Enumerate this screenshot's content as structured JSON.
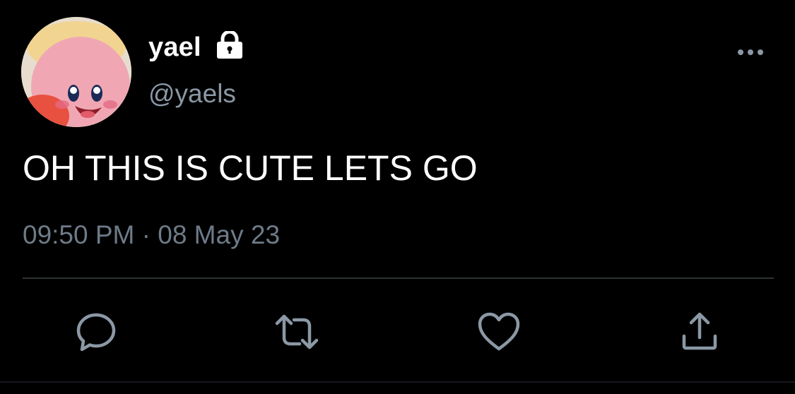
{
  "user": {
    "display_name": "yael",
    "handle": "@yaels",
    "protected_icon": "lock-icon"
  },
  "tweet": {
    "text": "OH THIS IS CUTE LETS GO",
    "timestamp": "09:50 PM · 08 May 23"
  },
  "actions": [
    {
      "name": "reply",
      "icon": "reply-bubble-icon"
    },
    {
      "name": "retweet",
      "icon": "retweet-arrows-icon"
    },
    {
      "name": "like",
      "icon": "heart-icon"
    },
    {
      "name": "share",
      "icon": "share-upload-icon"
    }
  ],
  "colors": {
    "background": "#000000",
    "primary_text": "#ffffff",
    "secondary_text": "#8b98a5",
    "icon": "#8b98a5",
    "divider": "#2f3336"
  }
}
